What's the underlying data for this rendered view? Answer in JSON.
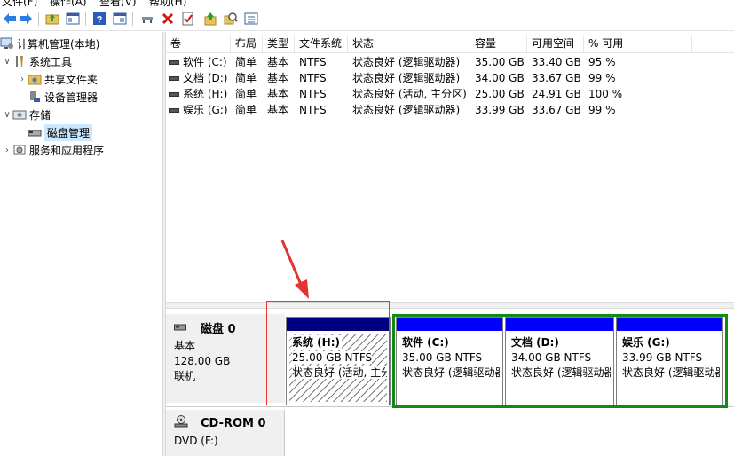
{
  "menubar": {
    "items": [
      "文件(F)",
      "操作(A)",
      "查看(V)",
      "帮助(H)"
    ]
  },
  "toolbar": {
    "icons": [
      "back-icon",
      "forward-icon",
      "up-folder-icon",
      "show-hide-tree-icon",
      "help-icon",
      "properties-icon",
      "connect-icon",
      "delete-icon",
      "check-icon",
      "export-icon",
      "search-icon",
      "list-icon"
    ]
  },
  "tree": {
    "root": "计算机管理(本地)",
    "system_tools": "系统工具",
    "shared_folders": "共享文件夹",
    "device_manager": "设备管理器",
    "storage": "存储",
    "disk_management": "磁盘管理",
    "services_apps": "服务和应用程序"
  },
  "volumes": {
    "headers": [
      "卷",
      "布局",
      "类型",
      "文件系统",
      "状态",
      "容量",
      "可用空间",
      "% 可用"
    ],
    "rows": [
      {
        "name": "软件 (C:)",
        "layout": "简单",
        "type": "基本",
        "fs": "NTFS",
        "status": "状态良好 (逻辑驱动器)",
        "capacity": "35.00 GB",
        "free": "33.40 GB",
        "pct": "95 %"
      },
      {
        "name": "文档 (D:)",
        "layout": "简单",
        "type": "基本",
        "fs": "NTFS",
        "status": "状态良好 (逻辑驱动器)",
        "capacity": "34.00 GB",
        "free": "33.67 GB",
        "pct": "99 %"
      },
      {
        "name": "系统 (H:)",
        "layout": "简单",
        "type": "基本",
        "fs": "NTFS",
        "status": "状态良好 (活动, 主分区)",
        "capacity": "25.00 GB",
        "free": "24.91 GB",
        "pct": "100 %"
      },
      {
        "name": "娱乐 (G:)",
        "layout": "简单",
        "type": "基本",
        "fs": "NTFS",
        "status": "状态良好 (逻辑驱动器)",
        "capacity": "33.99 GB",
        "free": "33.67 GB",
        "pct": "99 %"
      }
    ]
  },
  "disk0": {
    "name": "磁盘 0",
    "type": "基本",
    "size": "128.00 GB",
    "state": "联机",
    "partitions": [
      {
        "name": "系统  (H:)",
        "size": "25.00 GB NTFS",
        "status": "状态良好 (活动, 主分区)"
      },
      {
        "name": "软件  (C:)",
        "size": "35.00 GB NTFS",
        "status": "状态良好 (逻辑驱动器)"
      },
      {
        "name": "文档  (D:)",
        "size": "34.00 GB NTFS",
        "status": "状态良好 (逻辑驱动器)"
      },
      {
        "name": "娱乐  (G:)",
        "size": "33.99 GB NTFS",
        "status": "状态良好 (逻辑驱动器)"
      }
    ]
  },
  "cdrom": {
    "name": "CD-ROM 0",
    "line": "DVD (F:)"
  },
  "colors": {
    "primary_bar": "#000080",
    "logical_bar": "#0000ff",
    "extended_border": "#138a13",
    "selection": "#cce8ff",
    "annotation": "#e33333"
  }
}
